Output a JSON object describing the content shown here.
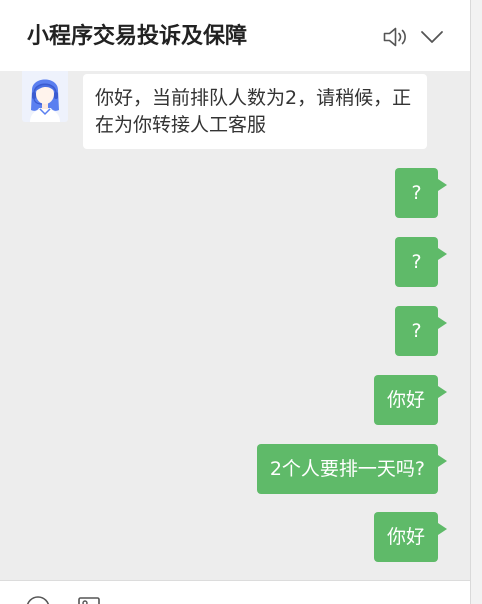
{
  "window": {
    "title": "小程序交易投诉及保障",
    "header_icons": {
      "sound": "speaker-icon",
      "collapse": "chevron-down-icon"
    }
  },
  "chat": {
    "incoming": [
      {
        "avatar": "customer-service-avatar",
        "text": "你好，当前排队人数为2，请稍候，正在为你转接人工客服"
      }
    ],
    "outgoing": [
      {
        "text": "?"
      },
      {
        "text": "?"
      },
      {
        "text": "?"
      },
      {
        "text": "你好"
      },
      {
        "text": "2个人要排一天吗?"
      },
      {
        "text": "你好"
      }
    ]
  },
  "input_toolbar": {
    "icons": [
      "emoji-icon",
      "image-icon"
    ]
  },
  "theme": {
    "chat_bg": "#ededed",
    "header_bg": "#ffffff",
    "user_bubble": "#5fba69",
    "user_text": "#ffffff",
    "agent_bubble": "#ffffff",
    "agent_text": "#333333",
    "icon": "#555555",
    "title": "#222222"
  }
}
